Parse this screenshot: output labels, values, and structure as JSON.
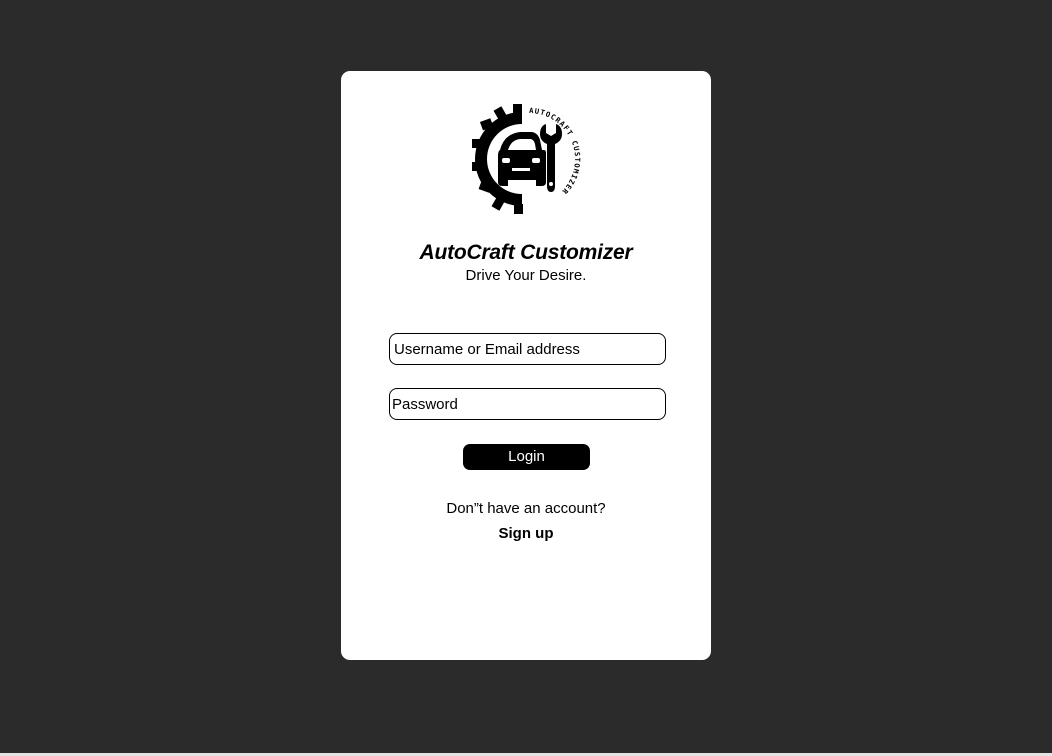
{
  "app": {
    "title": "AutoCraft Customizer",
    "tagline": "Drive Your Desire."
  },
  "logo": {
    "icon": "gear-car-wrench-logo",
    "text": "AUTOCRAFT CUSTOMIZER"
  },
  "form": {
    "username_placeholder": "Username or Email address",
    "password_placeholder": "Password",
    "login_label": "Login"
  },
  "footer": {
    "prompt": "Don”t have an account?",
    "signup_label": "Sign up"
  },
  "colors": {
    "background": "#2b2b2b",
    "card": "#ffffff",
    "primary": "#000000"
  }
}
